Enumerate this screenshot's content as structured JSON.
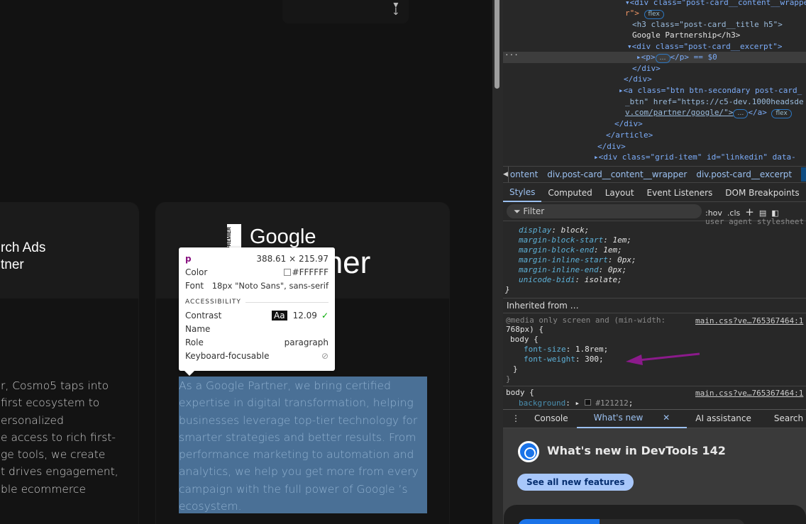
{
  "page": {
    "card1": {
      "title_lines": [
        "rch Ads",
        "tner"
      ],
      "excerpt": "r, Cosmo5 taps into\nfirst ecosystem to\nersonalized\ne access to rich first-\nge tools, we create\nt drives engagement,\nble ecommerce"
    },
    "card2": {
      "logo_badge": "PREMIER",
      "logo_word": "Google",
      "logo_word2": "Partner",
      "excerpt": "As a Google Partner, we bring certified\nexpertise in digital transformation, helping\nbusinesses leverage top-tier technology for\nsmarter strategies and better results. From\nperformance marketing to automation and\nanalytics, we help you get more from every\ncampaign with the full power of Google ’s\necosystem."
    }
  },
  "tooltip": {
    "tag": "p",
    "size": "388.61 × 215.97",
    "color_label": "Color",
    "color_value": "#FFFFFF",
    "font_label": "Font",
    "font_value": "18px \"Noto Sans\", sans-serif",
    "section": "ACCESSIBILITY",
    "contrast_label": "Contrast",
    "contrast_sample": "Aa",
    "contrast_value": "12.09",
    "name_label": "Name",
    "role_label": "Role",
    "role_value": "paragraph",
    "focus_label": "Keyboard-focusable"
  },
  "elements": {
    "lines": [
      "<div class=\"post-card__content__wrappe",
      "r\">",
      "<h3 class=\"post-card__title h5\">",
      "Google Partnership</h3>",
      "<div class=\"post-card__excerpt\">",
      "<p>",
      "</p> == $0",
      "</div>",
      "</div>",
      "<a class=\"btn btn-secondary post-card_",
      "_btn\" href=\"https://c5-dev.1000headsde",
      "v.com/partner/google/\">",
      "</a>",
      "</div>",
      "</article>",
      "</div>",
      "<div class=\"grid-item\" id=\"linkedin\" data-"
    ],
    "badge_flex": "flex"
  },
  "breadcrumbs": [
    "ontent",
    "div.post-card__content__wrapper",
    "div.post-card__excerpt",
    "p"
  ],
  "panel_tabs": [
    "Styles",
    "Computed",
    "Layout",
    "Event Listeners",
    "DOM Breakpoints"
  ],
  "filter_placeholder": "Filter",
  "filter_tools": [
    ":hov",
    ".cls"
  ],
  "styles": {
    "ua_source": "user agent stylesheet",
    "ua_props": [
      [
        "display",
        "block"
      ],
      [
        "margin-block-start",
        "1em"
      ],
      [
        "margin-block-end",
        "1em"
      ],
      [
        "margin-inline-start",
        "0px"
      ],
      [
        "margin-inline-end",
        "0px"
      ],
      [
        "unicode-bidi",
        "isolate"
      ]
    ],
    "inherited": "Inherited from …",
    "media": "@media only screen and (min-width:",
    "media2": "768px) {",
    "rule1_selector": "body {",
    "rule1_props": [
      [
        "font-size",
        "1.8rem"
      ],
      [
        "font-weight",
        "300"
      ]
    ],
    "source": "main.css?ve…765367464:1",
    "rule2_selector": "body {",
    "rule2_prop": [
      "background",
      "#121212"
    ]
  },
  "drawer_tabs": [
    "Console",
    "What's new",
    "AI assistance",
    "Search"
  ],
  "whats_new": {
    "title": "What's new in DevTools 142",
    "button": "See all new features"
  },
  "colors": {
    "page_bg": "#121212",
    "highlight": "#4a7096",
    "accent": "#9bc0f0",
    "annotation_arrow": "#8b1a8b"
  }
}
